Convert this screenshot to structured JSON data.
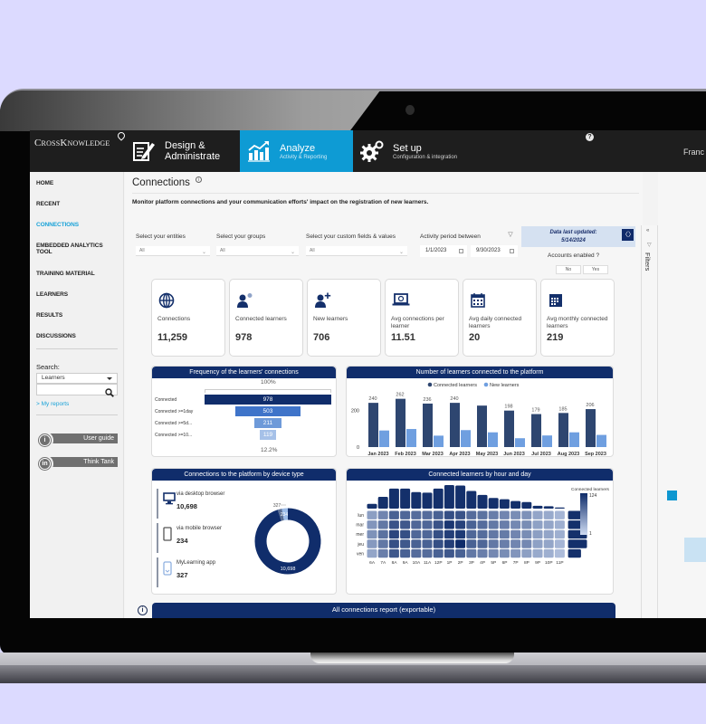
{
  "topnav": {
    "logo": "CrossKnowledge",
    "tabs": [
      {
        "title": "Design &",
        "title2": "Administrate",
        "subtitle": "",
        "icon": "edit-document-icon",
        "active": false
      },
      {
        "title": "Analyze",
        "subtitle": "Activity & Reporting",
        "icon": "chart-growth-icon",
        "active": true
      },
      {
        "title": "Set up",
        "subtitle": "Configuration & integration",
        "icon": "gears-icon",
        "active": false
      }
    ],
    "help": "?",
    "user": "Franc"
  },
  "sidebar": {
    "items": [
      {
        "label": "HOME",
        "active": false
      },
      {
        "label": "RECENT",
        "active": false
      },
      {
        "label": "CONNECTIONS",
        "active": true
      },
      {
        "label": "EMBEDDED ANALYTICS",
        "label2": "TOOL",
        "active": false
      },
      {
        "label": "TRAINING MATERIAL",
        "active": false
      },
      {
        "label": "LEARNERS",
        "active": false
      },
      {
        "label": "RESULTS",
        "active": false
      },
      {
        "label": "DISCUSSIONS",
        "active": false
      }
    ],
    "search_label": "Search:",
    "search_select": "Learners",
    "search_value": "",
    "my_reports": "> My reports",
    "links": [
      {
        "label": "User guide",
        "icon": "info-icon",
        "glyph": "i"
      },
      {
        "label": "Think Tank",
        "icon": "linkedin-icon",
        "glyph": "in"
      }
    ]
  },
  "page": {
    "title": "Connections",
    "info": "i",
    "subtitle": "Monitor platform connections and your communication efforts' impact on the registration of new learners."
  },
  "filters": {
    "entities": {
      "label": "Select your entities",
      "value": "All"
    },
    "groups": {
      "label": "Select your groups",
      "value": "All"
    },
    "custom": {
      "label": "Select your custom fields & values",
      "value": "All"
    },
    "period": {
      "label": "Activity period between",
      "start": "1/1/2023",
      "end": "9/30/2023"
    },
    "updated_line1": "Data last updated:",
    "updated_line2": "5/14/2024",
    "accounts_label": "Accounts enabled ?",
    "accounts_options": [
      "No",
      "Yes"
    ],
    "pane_label": "Filters"
  },
  "kpis": [
    {
      "label": "Connections",
      "value": "11,259",
      "icon": "globe-icon"
    },
    {
      "label": "Connected learners",
      "value": "978",
      "icon": "user-connected-icon"
    },
    {
      "label": "New learners",
      "value": "706",
      "icon": "user-add-icon"
    },
    {
      "label": "Avg connections per learner",
      "value": "11.51",
      "icon": "laptop-icon"
    },
    {
      "label": "Avg daily connected learners",
      "value": "20",
      "icon": "calendar-icon"
    },
    {
      "label": "Avg monthly connected learners",
      "value": "219",
      "icon": "calendar-month-icon"
    }
  ],
  "chart_data": [
    {
      "type": "bar",
      "subtype": "funnel",
      "title": "Frequency of the learners' connections",
      "categories": [
        "Connected",
        "Connected >=1day",
        "Connected >=5d...",
        "Connected >=10..."
      ],
      "values": [
        978,
        503,
        211,
        119
      ],
      "top_label": "100%",
      "bottom_label": "12.2%",
      "colors": [
        "#102d6b",
        "#3f74c9",
        "#6e9ad9",
        "#a6c1e8"
      ]
    },
    {
      "type": "bar",
      "title": "Number of learners connected to the platform",
      "categories": [
        "Jan 2023",
        "Feb 2023",
        "Mar 2023",
        "Apr 2023",
        "May 2023",
        "Jun 2023",
        "Jul 2023",
        "Aug 2023",
        "Sep 2023"
      ],
      "series": [
        {
          "name": "Connected learners",
          "values": [
            240,
            262,
            236,
            240,
            225,
            198,
            179,
            185,
            206
          ],
          "color": "#2e4670",
          "labels": [
            "240",
            "262",
            "236",
            "240",
            "",
            "198",
            "179",
            "185",
            "206"
          ]
        },
        {
          "name": "New learners",
          "values": [
            90,
            98,
            62,
            92,
            80,
            48,
            63,
            80,
            66
          ],
          "color": "#6f9fe0"
        }
      ],
      "yticks": [
        0,
        200
      ],
      "ylim": [
        0,
        275
      ],
      "legend": "top"
    },
    {
      "type": "pie",
      "subtype": "donut",
      "title": "Connections to the platform by device type",
      "categories": [
        "via desktop browser",
        "via mobile browser",
        "MyLearning app"
      ],
      "values": [
        10698,
        234,
        327
      ],
      "display_values": [
        "10,698",
        "234",
        "327"
      ],
      "colors": [
        "#102d6b",
        "#5a6f95",
        "#9cbce8"
      ]
    },
    {
      "type": "heatmap",
      "title": "Connected learners by hour and day",
      "x": [
        "6A",
        "7A",
        "8A",
        "9A",
        "10A",
        "11A",
        "12P",
        "1P",
        "2P",
        "3P",
        "4P",
        "5P",
        "6P",
        "7P",
        "8P",
        "9P",
        "10P",
        "11P"
      ],
      "y": [
        "lun",
        "mar",
        "mer",
        "jeu",
        "ven"
      ],
      "values": [
        [
          15,
          30,
          60,
          55,
          50,
          50,
          60,
          80,
          75,
          50,
          45,
          35,
          30,
          25,
          22,
          12,
          10,
          6
        ],
        [
          20,
          40,
          75,
          70,
          55,
          55,
          75,
          110,
          95,
          60,
          50,
          40,
          35,
          28,
          25,
          14,
          12,
          8
        ],
        [
          22,
          45,
          90,
          80,
          55,
          55,
          80,
          100,
          105,
          55,
          50,
          40,
          38,
          30,
          25,
          15,
          12,
          8
        ],
        [
          18,
          40,
          80,
          70,
          60,
          60,
          80,
          100,
          124,
          60,
          55,
          40,
          35,
          30,
          28,
          14,
          12,
          6
        ],
        [
          12,
          35,
          70,
          60,
          50,
          50,
          60,
          70,
          60,
          40,
          35,
          28,
          25,
          20,
          15,
          10,
          8,
          4
        ]
      ],
      "column_totals": [
        0.2,
        0.5,
        0.85,
        0.85,
        0.7,
        0.68,
        0.85,
        1.0,
        0.98,
        0.75,
        0.58,
        0.45,
        0.4,
        0.32,
        0.28,
        0.12,
        0.1,
        0.05
      ],
      "row_totals": [
        0.8,
        0.95,
        0.95,
        0.95,
        0.65
      ],
      "legend_title": "Connected learners",
      "legend_min": "1",
      "legend_max": "124",
      "color_low": "#cfdcf3",
      "color_high": "#0f2c6a"
    }
  ],
  "report": {
    "title": "All connections report (exportable)",
    "info": "i"
  }
}
